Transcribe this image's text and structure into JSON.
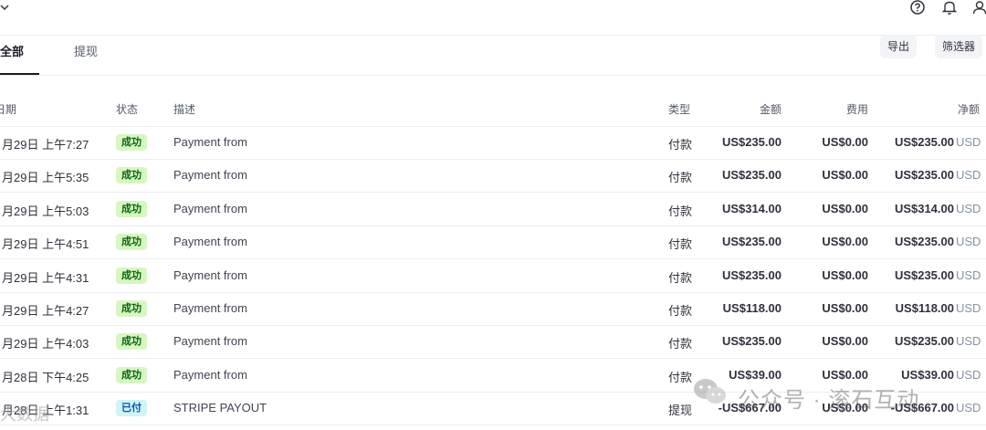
{
  "header": {
    "icons": [
      "chevron-down-icon",
      "help-icon",
      "bell-icon",
      "user-icon"
    ]
  },
  "tabs": [
    {
      "label": "全部",
      "active": true
    },
    {
      "label": "提现",
      "active": false
    }
  ],
  "actions": {
    "export_label": "导出",
    "filter_label": "筛选器"
  },
  "table": {
    "columns": {
      "date": "日期",
      "status": "状态",
      "description": "描述",
      "type": "类型",
      "amount": "金额",
      "fee": "费用",
      "net": "净额"
    },
    "rows": [
      {
        "date": "月29日 上午7:27",
        "status": "成功",
        "status_kind": "success",
        "description": "Payment from",
        "type": "付款",
        "amount": "US$235.00",
        "fee": "US$0.00",
        "net": "US$235.00",
        "currency": "USD"
      },
      {
        "date": "月29日 上午5:35",
        "status": "成功",
        "status_kind": "success",
        "description": "Payment from",
        "type": "付款",
        "amount": "US$235.00",
        "fee": "US$0.00",
        "net": "US$235.00",
        "currency": "USD"
      },
      {
        "date": "月29日 上午5:03",
        "status": "成功",
        "status_kind": "success",
        "description": "Payment from",
        "type": "付款",
        "amount": "US$314.00",
        "fee": "US$0.00",
        "net": "US$314.00",
        "currency": "USD"
      },
      {
        "date": "月29日 上午4:51",
        "status": "成功",
        "status_kind": "success",
        "description": "Payment from",
        "type": "付款",
        "amount": "US$235.00",
        "fee": "US$0.00",
        "net": "US$235.00",
        "currency": "USD"
      },
      {
        "date": "月29日 上午4:31",
        "status": "成功",
        "status_kind": "success",
        "description": "Payment from",
        "type": "付款",
        "amount": "US$235.00",
        "fee": "US$0.00",
        "net": "US$235.00",
        "currency": "USD"
      },
      {
        "date": "月29日 上午4:27",
        "status": "成功",
        "status_kind": "success",
        "description": "Payment from",
        "type": "付款",
        "amount": "US$118.00",
        "fee": "US$0.00",
        "net": "US$118.00",
        "currency": "USD"
      },
      {
        "date": "月29日 上午4:03",
        "status": "成功",
        "status_kind": "success",
        "description": "Payment from",
        "type": "付款",
        "amount": "US$235.00",
        "fee": "US$0.00",
        "net": "US$235.00",
        "currency": "USD"
      },
      {
        "date": "月28日 下午4:25",
        "status": "成功",
        "status_kind": "success",
        "description": "Payment from",
        "type": "付款",
        "amount": "US$39.00",
        "fee": "US$0.00",
        "net": "US$39.00",
        "currency": "USD"
      },
      {
        "date": "月28日 上午1:31",
        "status": "已付",
        "status_kind": "paid",
        "description": "STRIPE PAYOUT",
        "type": "提现",
        "amount": "-US$667.00",
        "fee": "US$0.00",
        "net": "-US$667.00",
        "currency": "USD"
      }
    ]
  },
  "watermark": {
    "text": "公众号 · 滚石互动",
    "text2": "大数据"
  },
  "colors": {
    "success_bg": "#d7f7c2",
    "success_text": "#05690d",
    "paid_bg": "#cff5f6",
    "paid_text": "#0055bc",
    "divider": "#ebeef1"
  }
}
